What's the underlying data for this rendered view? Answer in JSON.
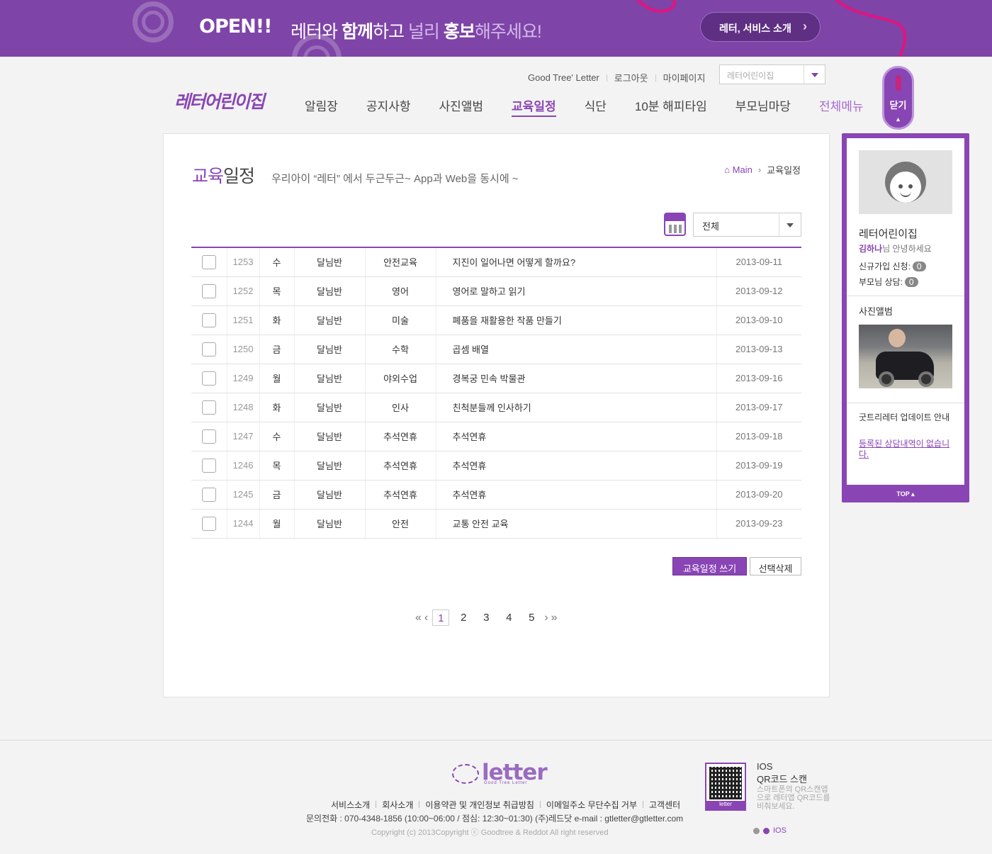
{
  "promo": {
    "open": "OPEN!!",
    "headline_a": "레터와 ",
    "headline_b": "함께",
    "headline_c": "하고 ",
    "headline_d": "널리 ",
    "headline_e": "홍보",
    "headline_f": "해주세요!",
    "button": "레터, 서비스 소개"
  },
  "header": {
    "util_links": [
      "Good Tree' Letter",
      "로그아웃",
      "마이페이지"
    ],
    "site_select": "레터어린이집",
    "logo": "레터어린이집",
    "nav": [
      "알림장",
      "공지사항",
      "사진앨범",
      "교육일정",
      "식단",
      "10분 해피타임",
      "부모님마당",
      "전체메뉴"
    ],
    "nav_active_index": 3
  },
  "side": {
    "close_label": "닫기",
    "name": "레터어린이집",
    "hello_name": "김하나",
    "hello_suffix": "님 안녕하세요",
    "signup_label": "신규가입 신청:",
    "signup_count": "0",
    "consult_label": "부모님 상담:",
    "consult_count": "0",
    "album_title": "사진앨범",
    "update_title": "굿트리레터 업데이트 안내",
    "update_link": "등록된 상담내역이 없습니다.",
    "top": "TOP ▴"
  },
  "page": {
    "title_hl": "교육",
    "title_rest": "일정",
    "subtitle": "우리아이 “레터” 에서 두근두근~ App과 Web을 동시에 ~",
    "crumb_home": "Main",
    "crumb_current": "교육일정",
    "filter": "전체",
    "rows": [
      {
        "no": "1253",
        "day": "수",
        "class": "달님반",
        "cat": "안전교육",
        "title": "지진이 일어나면 어떻게 할까요?",
        "date": "2013-09-11"
      },
      {
        "no": "1252",
        "day": "목",
        "class": "달님반",
        "cat": "영어",
        "title": "영어로 말하고 읽기",
        "date": "2013-09-12"
      },
      {
        "no": "1251",
        "day": "화",
        "class": "달님반",
        "cat": "미술",
        "title": "폐품을 재활용한 작품 만들기",
        "date": "2013-09-10"
      },
      {
        "no": "1250",
        "day": "금",
        "class": "달님반",
        "cat": "수학",
        "title": "곱셈 배열",
        "date": "2013-09-13"
      },
      {
        "no": "1249",
        "day": "월",
        "class": "달님반",
        "cat": "야외수업",
        "title": "경복궁 민속 박물관",
        "date": "2013-09-16"
      },
      {
        "no": "1248",
        "day": "화",
        "class": "달님반",
        "cat": "인사",
        "title": "친척분들께 인사하기",
        "date": "2013-09-17"
      },
      {
        "no": "1247",
        "day": "수",
        "class": "달님반",
        "cat": "추석연휴",
        "title": "추석연휴",
        "date": "2013-09-18"
      },
      {
        "no": "1246",
        "day": "목",
        "class": "달님반",
        "cat": "추석연휴",
        "title": "추석연휴",
        "date": "2013-09-19"
      },
      {
        "no": "1245",
        "day": "금",
        "class": "달님반",
        "cat": "추석연휴",
        "title": "추석연휴",
        "date": "2013-09-20"
      },
      {
        "no": "1244",
        "day": "월",
        "class": "달님반",
        "cat": "안전",
        "title": "교통 안전 교육",
        "date": "2013-09-23"
      }
    ],
    "write_button": "교육일정 쓰기",
    "delete_button": "선택삭제",
    "pages": [
      "1",
      "2",
      "3",
      "4",
      "5"
    ],
    "current_page": "1"
  },
  "footer": {
    "logo": "letter",
    "logo_sub": "Good Tree Letter",
    "links": [
      "서비스소개",
      "회사소개",
      "이용약관 및 개인정보 취급방침",
      "이메일주소 무단수집 거부",
      "고객센터"
    ],
    "contact": "문의전화 : 070-4348-1856 (10:00~06:00 / 점심: 12:30~01:30) (주)레드닷    e-mail : gtletter@gtletter.com",
    "copyright": "Copyright (c) 2013Copyright ⓒ Goodtree & Reddot All right reserved",
    "qr_label": "letter",
    "qr_os": "IOS",
    "qr_title": "QR코드 스캔",
    "qr_desc": "스마트폰의 QR스캔앱으로 레터앱 QR코드를 비춰보세요.",
    "qr_tab": "IOS"
  },
  "colors": {
    "brand": "#8a45b5",
    "banner": "#7e44a7",
    "ribbon": "#e0157f"
  }
}
